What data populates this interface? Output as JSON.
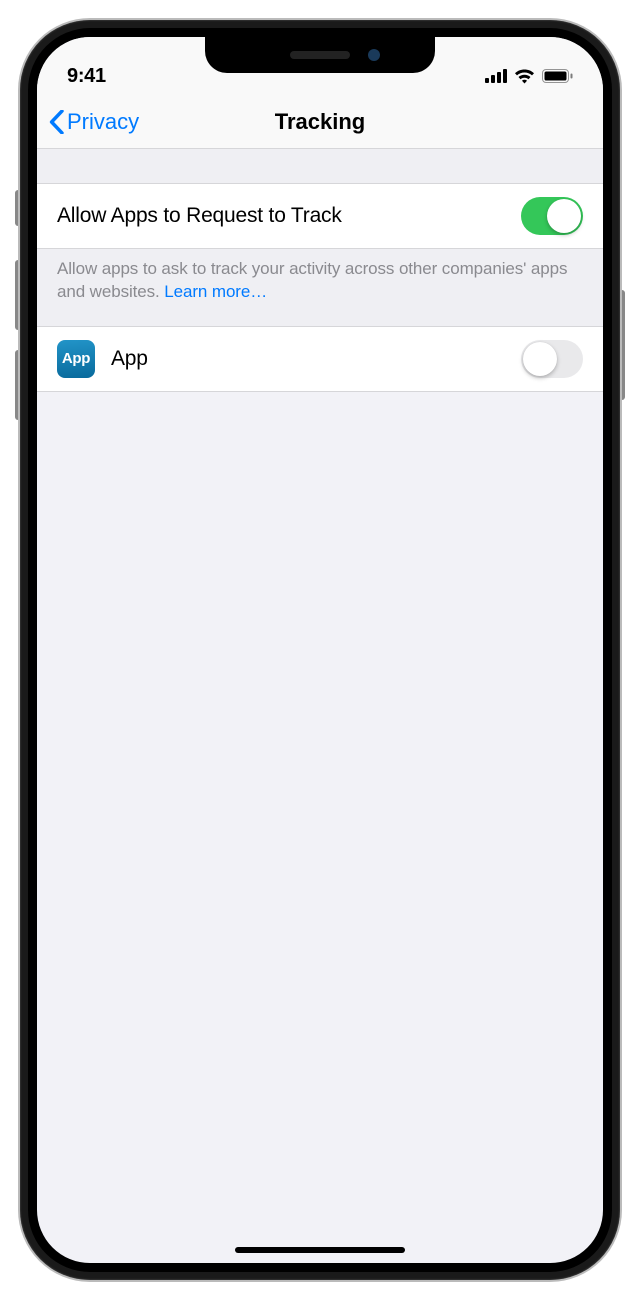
{
  "status": {
    "time": "9:41"
  },
  "nav": {
    "back_label": "Privacy",
    "title": "Tracking"
  },
  "settings": {
    "allow_track_label": "Allow Apps to Request to Track",
    "allow_track_on": true,
    "footer_text": "Allow apps to ask to track your activity across other companies' apps and websites. ",
    "learn_more": "Learn more…"
  },
  "apps": [
    {
      "name": "App",
      "icon_text": "App",
      "enabled": false
    }
  ]
}
